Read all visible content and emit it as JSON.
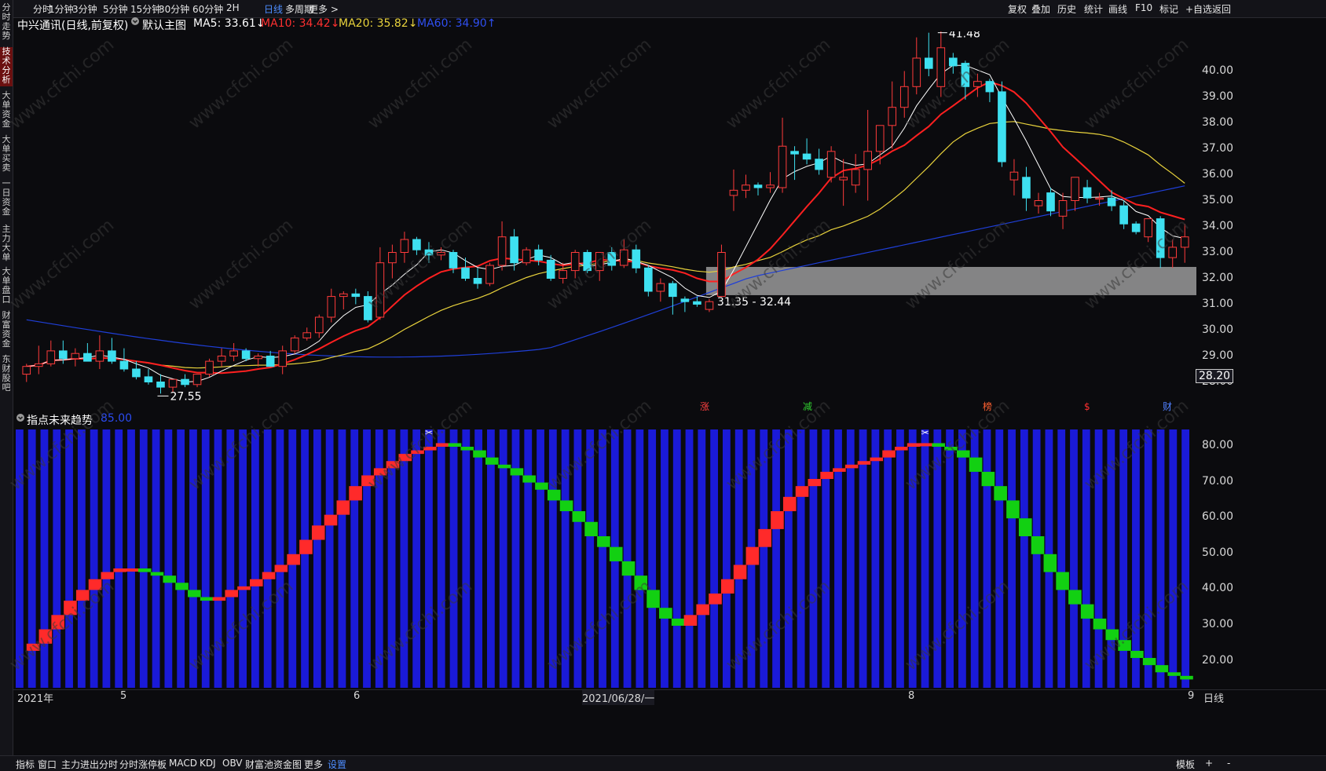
{
  "toolbar": {
    "periods": [
      "分时",
      "1分钟",
      "3分钟",
      "5分钟",
      "15分钟",
      "30分钟",
      "60分钟",
      "2H",
      "日线",
      "多周期",
      "更多 >"
    ],
    "active_period": "日线",
    "right_items": [
      "复权",
      "叠加",
      "历史",
      "统计",
      "画线",
      "F10",
      "标记",
      "+自选",
      "返回"
    ]
  },
  "left_rail": [
    {
      "label": "分时走势",
      "active": false
    },
    {
      "label": "技术分析",
      "active": true
    },
    {
      "label": "大单资金",
      "active": false
    },
    {
      "label": "大单买卖",
      "active": false
    },
    {
      "label": "一日资金",
      "active": false
    },
    {
      "label": "主力大单",
      "active": false
    },
    {
      "label": "大单盘口",
      "active": false
    },
    {
      "label": "财富资金",
      "active": false
    },
    {
      "label": "东财股吧",
      "active": false
    }
  ],
  "main_legend": {
    "stock": "中兴通讯(日线,前复权)",
    "template": "默认主图",
    "ma5": "MA5: 33.61↓",
    "ma10": "MA10: 34.42↓",
    "ma20": "MA20: 35.82↓",
    "ma60": "MA60: 34.90↑"
  },
  "colors": {
    "up": "#ff3b3b",
    "down": "#3ee0f0",
    "ma5": "#ffffff",
    "ma10": "#ff2020",
    "ma20": "#e8d23c",
    "ma60": "#1f3fd8",
    "gap_box": "#9a9a9a",
    "ind_bar": "#1a1ad8",
    "ind_up": "#ff2a2a",
    "ind_down": "#12d012",
    "watermark": "#3a3a3a"
  },
  "price_axis": {
    "ticks": [
      "40.00",
      "39.00",
      "38.00",
      "37.00",
      "36.00",
      "35.00",
      "34.00",
      "33.00",
      "32.00",
      "31.00",
      "30.00",
      "29.00",
      "28.00"
    ],
    "current": "28.20"
  },
  "annotations": {
    "high": "41.48",
    "low": "27.55",
    "gap": "31.35 - 32.44",
    "events": [
      "涨",
      "减",
      "榜",
      "$",
      "财"
    ]
  },
  "indicator": {
    "name": "指点未来趋势",
    "value": "85.00",
    "ticks": [
      "80.00",
      "70.00",
      "60.00",
      "50.00",
      "40.00",
      "30.00",
      "20.00"
    ]
  },
  "date_axis": {
    "labels": [
      "2021年",
      "5",
      "6",
      "2021/06/28/一",
      "8",
      "9"
    ],
    "right_label": "日线"
  },
  "bottom_tabs": {
    "items": [
      "指标",
      "窗口",
      "主力进出分时",
      "分时涨停板",
      "MACD",
      "KDJ",
      "OBV",
      "财富池资金图",
      "更多",
      "设置"
    ],
    "active": "设置",
    "right": [
      "模板",
      "+",
      "-"
    ]
  },
  "watermark_text": "www.cfchi.com",
  "chart_data": {
    "type": "candlestick",
    "title": "中兴通讯(日线,前复权)",
    "ylim": [
      27.5,
      41.8
    ],
    "ohlc": [
      [
        28.3,
        28.7,
        28.0,
        28.6
      ],
      [
        28.6,
        29.4,
        28.3,
        28.7
      ],
      [
        28.7,
        29.6,
        28.6,
        29.2
      ],
      [
        29.2,
        29.6,
        28.7,
        28.9
      ],
      [
        28.9,
        29.3,
        28.6,
        29.1
      ],
      [
        29.1,
        29.5,
        28.8,
        28.8
      ],
      [
        28.8,
        29.8,
        28.5,
        29.2
      ],
      [
        29.2,
        29.7,
        28.7,
        28.8
      ],
      [
        28.8,
        29.3,
        28.4,
        28.5
      ],
      [
        28.5,
        28.8,
        28.1,
        28.2
      ],
      [
        28.2,
        28.5,
        27.9,
        28.0
      ],
      [
        28.0,
        28.3,
        27.55,
        27.8
      ],
      [
        27.8,
        28.1,
        27.6,
        28.1
      ],
      [
        28.1,
        28.3,
        27.8,
        27.9
      ],
      [
        27.9,
        28.3,
        27.8,
        28.3
      ],
      [
        28.3,
        28.9,
        28.2,
        28.8
      ],
      [
        28.8,
        29.3,
        28.6,
        29.0
      ],
      [
        29.0,
        29.5,
        28.8,
        29.2
      ],
      [
        29.2,
        29.3,
        28.8,
        28.9
      ],
      [
        28.9,
        29.1,
        28.6,
        29.0
      ],
      [
        29.0,
        29.2,
        28.6,
        28.6
      ],
      [
        28.6,
        29.4,
        28.3,
        29.2
      ],
      [
        29.2,
        29.8,
        29.1,
        29.7
      ],
      [
        29.7,
        30.1,
        29.6,
        29.9
      ],
      [
        29.9,
        30.6,
        29.7,
        30.5
      ],
      [
        30.5,
        31.6,
        30.3,
        31.3
      ],
      [
        31.3,
        31.5,
        30.8,
        31.4
      ],
      [
        31.4,
        31.6,
        31.0,
        31.3
      ],
      [
        31.3,
        31.5,
        30.3,
        30.4
      ],
      [
        30.5,
        33.2,
        30.4,
        32.6
      ],
      [
        32.6,
        33.3,
        32.0,
        33.0
      ],
      [
        33.0,
        33.8,
        32.6,
        33.5
      ],
      [
        33.5,
        33.6,
        32.9,
        33.1
      ],
      [
        33.1,
        33.4,
        32.6,
        32.9
      ],
      [
        32.9,
        33.2,
        32.7,
        33.0
      ],
      [
        33.0,
        33.1,
        32.2,
        32.4
      ],
      [
        32.4,
        32.8,
        31.9,
        32.0
      ],
      [
        32.0,
        32.4,
        31.6,
        31.8
      ],
      [
        31.8,
        32.6,
        31.7,
        32.5
      ],
      [
        32.5,
        34.2,
        32.3,
        33.6
      ],
      [
        33.6,
        33.9,
        32.3,
        32.6
      ],
      [
        32.6,
        33.2,
        32.5,
        33.1
      ],
      [
        33.1,
        33.3,
        32.5,
        32.7
      ],
      [
        32.7,
        32.9,
        31.9,
        32.0
      ],
      [
        32.0,
        32.6,
        31.8,
        32.3
      ],
      [
        32.3,
        33.1,
        32.0,
        33.0
      ],
      [
        33.0,
        33.1,
        32.2,
        32.3
      ],
      [
        32.3,
        33.0,
        31.9,
        33.0
      ],
      [
        33.0,
        33.2,
        32.3,
        32.5
      ],
      [
        32.5,
        33.5,
        32.4,
        33.1
      ],
      [
        33.1,
        33.3,
        32.2,
        32.4
      ],
      [
        32.4,
        32.5,
        31.3,
        31.5
      ],
      [
        31.5,
        32.0,
        31.1,
        31.8
      ],
      [
        31.8,
        31.9,
        30.6,
        31.3
      ],
      [
        31.2,
        31.3,
        30.7,
        31.1
      ],
      [
        31.1,
        31.3,
        30.9,
        31.0
      ],
      [
        30.8,
        31.2,
        30.7,
        31.1
      ],
      [
        31.3,
        33.3,
        31.3,
        33.0
      ],
      [
        35.2,
        36.2,
        34.6,
        35.4
      ],
      [
        35.4,
        36.0,
        35.1,
        35.6
      ],
      [
        35.6,
        35.7,
        35.2,
        35.5
      ],
      [
        35.5,
        36.1,
        35.3,
        35.6
      ],
      [
        35.5,
        38.2,
        35.3,
        37.1
      ],
      [
        36.9,
        37.1,
        35.8,
        36.8
      ],
      [
        36.8,
        37.4,
        36.4,
        36.6
      ],
      [
        36.6,
        37.0,
        36.0,
        36.2
      ],
      [
        35.9,
        37.1,
        35.7,
        36.9
      ],
      [
        35.8,
        36.6,
        34.8,
        35.9
      ],
      [
        35.6,
        36.8,
        35.3,
        36.2
      ],
      [
        36.2,
        38.5,
        35.0,
        36.9
      ],
      [
        36.9,
        37.6,
        36.4,
        37.9
      ],
      [
        37.9,
        39.6,
        37.0,
        38.6
      ],
      [
        38.6,
        40.0,
        38.2,
        39.4
      ],
      [
        39.4,
        41.3,
        39.1,
        40.5
      ],
      [
        40.5,
        41.48,
        39.8,
        40.1
      ],
      [
        39.4,
        41.6,
        39.0,
        40.9
      ],
      [
        40.5,
        40.7,
        39.9,
        40.2
      ],
      [
        40.3,
        40.4,
        38.9,
        39.4
      ],
      [
        39.4,
        39.9,
        39.0,
        39.6
      ],
      [
        39.6,
        39.7,
        38.8,
        39.2
      ],
      [
        39.2,
        39.6,
        36.3,
        36.5
      ],
      [
        35.8,
        36.6,
        35.2,
        36.1
      ],
      [
        35.9,
        36.3,
        34.6,
        35.1
      ],
      [
        34.8,
        35.3,
        34.5,
        35.0
      ],
      [
        35.3,
        35.5,
        34.4,
        34.6
      ],
      [
        34.4,
        35.3,
        33.9,
        35.0
      ],
      [
        35.0,
        35.9,
        34.6,
        35.9
      ],
      [
        35.5,
        35.8,
        34.9,
        35.1
      ],
      [
        35.1,
        35.3,
        34.8,
        35.1
      ],
      [
        35.1,
        35.4,
        34.6,
        34.8
      ],
      [
        34.8,
        35.0,
        33.9,
        34.1
      ],
      [
        34.1,
        34.2,
        33.7,
        33.8
      ],
      [
        33.6,
        34.3,
        33.4,
        34.3
      ],
      [
        34.3,
        34.4,
        32.4,
        32.8
      ],
      [
        32.8,
        33.5,
        32.4,
        33.2
      ],
      [
        33.2,
        34.1,
        32.6,
        33.6
      ]
    ],
    "ma60_note": "MA60 trend line shown (blue)",
    "indicator_values": [
      23,
      25,
      29,
      33,
      37,
      40,
      43,
      45,
      46,
      46,
      45,
      44,
      42,
      40,
      38,
      37,
      38,
      40,
      41,
      43,
      45,
      47,
      50,
      54,
      58,
      61,
      65,
      69,
      72,
      74,
      76,
      78,
      79,
      80,
      81,
      80,
      79,
      77,
      75,
      74,
      72,
      70,
      68,
      65,
      62,
      59,
      55,
      52,
      48,
      44,
      40,
      35,
      32,
      30,
      33,
      36,
      39,
      43,
      47,
      52,
      57,
      62,
      66,
      69,
      71,
      73,
      74,
      75,
      76,
      77,
      79,
      80,
      81,
      81,
      80,
      79,
      77,
      73,
      69,
      65,
      60,
      55,
      50,
      45,
      40,
      36,
      32,
      29,
      26,
      23,
      21,
      19,
      17,
      16,
      15
    ]
  }
}
